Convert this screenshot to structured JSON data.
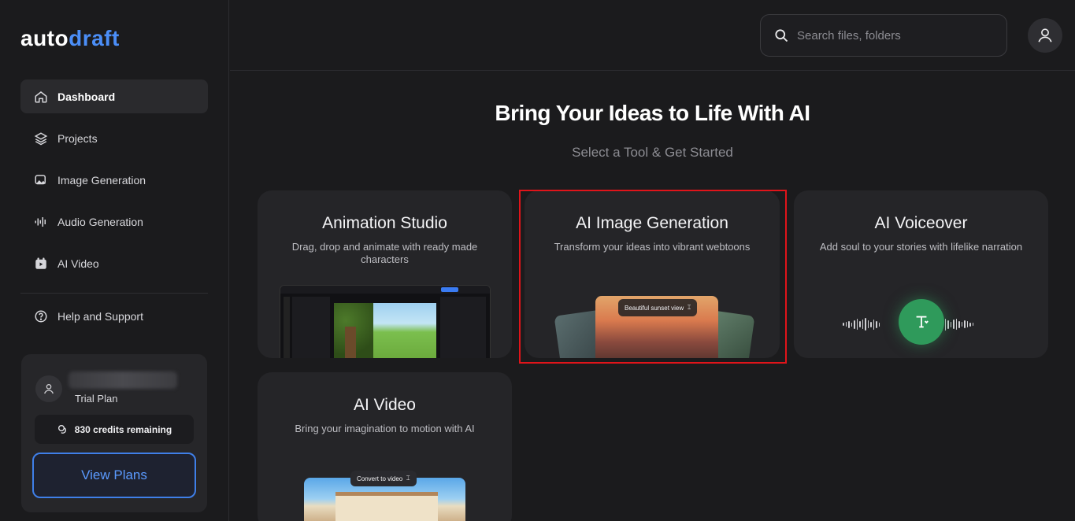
{
  "logo": {
    "part1": "auto",
    "part2": "draft"
  },
  "sidebar": {
    "items": [
      {
        "label": "Dashboard",
        "icon": "home-icon",
        "active": true
      },
      {
        "label": "Projects",
        "icon": "layers-icon"
      },
      {
        "label": "Image Generation",
        "icon": "ai-image-icon"
      },
      {
        "label": "Audio Generation",
        "icon": "audio-wave-icon"
      },
      {
        "label": "AI Video",
        "icon": "video-icon"
      }
    ],
    "help": {
      "label": "Help and Support",
      "icon": "help-circle-icon"
    }
  },
  "plan": {
    "type": "Trial Plan",
    "credits": "830 credits remaining",
    "view_plans": "View Plans"
  },
  "header": {
    "search_placeholder": "Search files, folders"
  },
  "hero": {
    "title": "Bring Your Ideas to Life With AI",
    "subtitle": "Select a Tool & Get Started"
  },
  "tools": [
    {
      "title": "Animation Studio",
      "desc": "Drag, drop and animate with ready made characters"
    },
    {
      "title": "AI Image Generation",
      "desc": "Transform your ideas into vibrant webtoons",
      "preview_label": "Beautiful sunset view"
    },
    {
      "title": "AI Voiceover",
      "desc": "Add soul to your stories with lifelike narration"
    },
    {
      "title": "AI Video",
      "desc": "Bring your imagination to motion with AI",
      "preview_label": "Convert to video"
    }
  ],
  "colors": {
    "accent": "#4b8ef7",
    "highlight": "#e0141a",
    "mic": "#2f9a5b"
  }
}
